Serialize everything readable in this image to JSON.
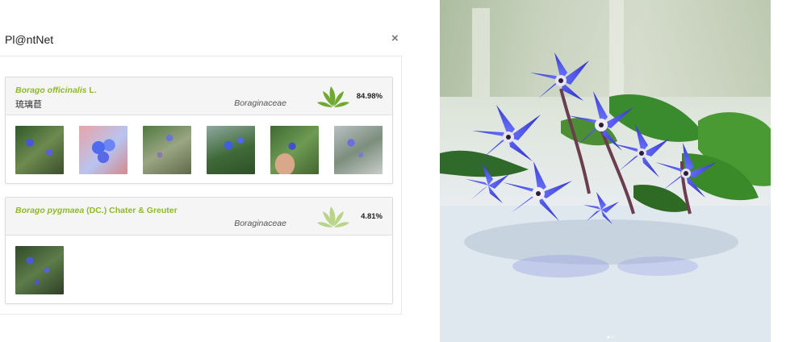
{
  "app": {
    "title": "Pl@ntNet",
    "close_label": "×"
  },
  "results": [
    {
      "scientific_name": "Borago officinalis",
      "author": "L.",
      "common_name": "琉璃苣",
      "family": "Boraginaceae",
      "score": "84.98%",
      "thumbnails": [
        "thumb-1",
        "thumb-2",
        "thumb-3",
        "thumb-4",
        "thumb-5",
        "thumb-6"
      ]
    },
    {
      "scientific_name": "Borago pygmaea",
      "author": "(DC.) Chater & Greuter",
      "common_name": "",
      "family": "Boraginaceae",
      "score": "4.81%",
      "thumbnails": [
        "thumb-1"
      ]
    }
  ],
  "colors": {
    "species_link": "#8fb82a",
    "leaf_strong": "#6fa92f",
    "leaf_faint": "#b8d486",
    "flower_blue": "#3b3fd6"
  },
  "icons": {
    "leaf": "leaf-score-icon",
    "close": "close-icon"
  }
}
